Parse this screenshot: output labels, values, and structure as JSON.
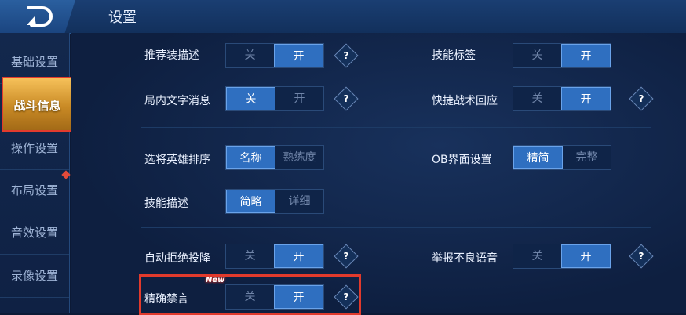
{
  "header": {
    "title": "设置"
  },
  "sidebar": {
    "items": [
      {
        "label": "基础设置"
      },
      {
        "label": "战斗信息"
      },
      {
        "label": "操作设置"
      },
      {
        "label": "布局设置"
      },
      {
        "label": "音效设置"
      },
      {
        "label": "录像设置"
      }
    ]
  },
  "settings": {
    "recommend_equip_desc": {
      "label": "推荐装描述",
      "opt1": "关",
      "opt2": "开",
      "selected": "开"
    },
    "skill_tag": {
      "label": "技能标签",
      "opt1": "关",
      "opt2": "开",
      "selected": "开"
    },
    "in_game_text": {
      "label": "局内文字消息",
      "opt1": "关",
      "opt2": "开",
      "selected": "关"
    },
    "quick_tactics_reply": {
      "label": "快捷战术回应",
      "opt1": "关",
      "opt2": "开",
      "selected": "开"
    },
    "hero_sort": {
      "label": "选将英雄排序",
      "opt1": "名称",
      "opt2": "熟练度",
      "selected": "名称"
    },
    "ob_ui": {
      "label": "OB界面设置",
      "opt1": "精简",
      "opt2": "完整",
      "selected": "精简"
    },
    "skill_desc": {
      "label": "技能描述",
      "opt1": "简略",
      "opt2": "详细",
      "selected": "简略"
    },
    "auto_refuse_surrender": {
      "label": "自动拒绝投降",
      "opt1": "关",
      "opt2": "开",
      "selected": "开"
    },
    "report_bad_voice": {
      "label": "举报不良语音",
      "opt1": "关",
      "opt2": "开",
      "selected": "开"
    },
    "precise_mute": {
      "label": "精确禁言",
      "opt1": "关",
      "opt2": "开",
      "selected": "开",
      "badge": "New"
    }
  },
  "help_glyph": "?",
  "colors": {
    "accent": "#2f6fc0",
    "highlight": "#e13a2c",
    "active_tab": "#f6c15a"
  }
}
